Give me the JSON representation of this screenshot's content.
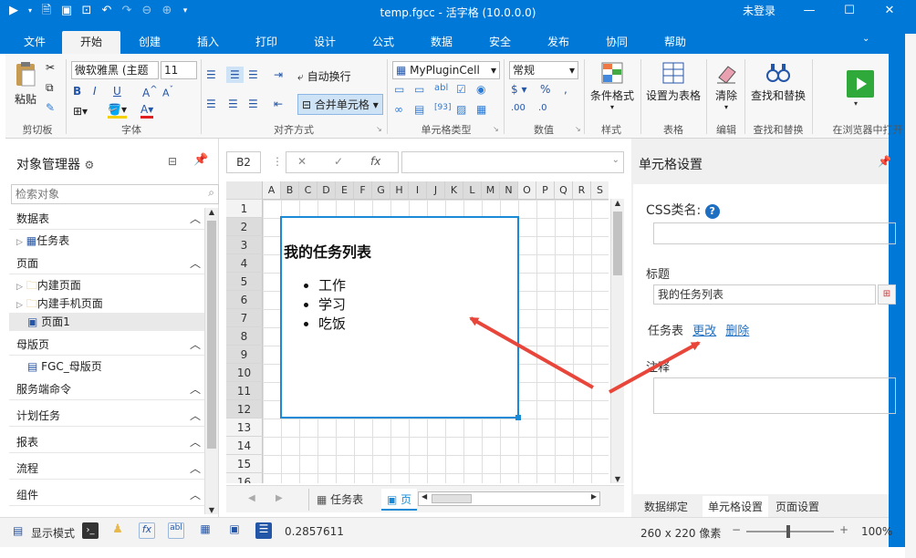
{
  "titlebar": {
    "title": "temp.fgcc - 活字格 (10.0.0.0)",
    "login_label": "未登录"
  },
  "ribbon_tabs": [
    "文件",
    "开始",
    "创建",
    "插入",
    "打印",
    "设计",
    "公式",
    "数据",
    "安全",
    "发布",
    "协同",
    "帮助"
  ],
  "ribbon": {
    "paste_label": "粘贴",
    "clipboard_group": "剪切板",
    "font_name": "微软雅黑 (主题",
    "font_size": "11",
    "font_group": "字体",
    "wrap_label": "自动换行",
    "merge_label": "合并单元格",
    "align_group": "对齐方式",
    "plugin_cell_value": "MyPluginCell",
    "celltype_group": "单元格类型",
    "number_format_value": "常规",
    "number_group": "数值",
    "cond_format_label": "条件格式",
    "style_group": "样式",
    "set_table_label": "设置为表格",
    "table_group": "表格",
    "clear_label": "清除",
    "edit_group": "编辑",
    "find_replace_label": "查找和替换",
    "find_group": "查找和替换",
    "open_browser_label": "在浏览器中打开"
  },
  "object_manager": {
    "title": "对象管理器",
    "search_placeholder": "检索对象",
    "sections": [
      {
        "label": "数据表",
        "items": [
          "任务表"
        ]
      },
      {
        "label": "页面",
        "items": [
          "内建页面",
          "内建手机页面",
          "页面1"
        ]
      },
      {
        "label": "母版页",
        "items": [
          "FGC_母版页"
        ]
      },
      {
        "label": "服务端命令"
      },
      {
        "label": "计划任务"
      },
      {
        "label": "报表"
      },
      {
        "label": "流程"
      },
      {
        "label": "组件"
      }
    ]
  },
  "formula_bar": {
    "cell_ref": "B2",
    "fx_label": "fx"
  },
  "sheet": {
    "columns": [
      "A",
      "B",
      "C",
      "D",
      "E",
      "F",
      "G",
      "H",
      "I",
      "J",
      "K",
      "L",
      "M",
      "N",
      "O",
      "P",
      "Q",
      "R",
      "S"
    ],
    "rows": [
      "1",
      "2",
      "3",
      "4",
      "5",
      "6",
      "7",
      "8",
      "9",
      "10",
      "11",
      "12",
      "13",
      "14",
      "15",
      "16"
    ],
    "cell_title": "我的任务列表",
    "cell_list": [
      "工作",
      "学习",
      "吃饭"
    ],
    "sheet_tabs": [
      "任务表",
      "页"
    ]
  },
  "cell_settings": {
    "title": "单元格设置",
    "css_label": "CSS类名:",
    "css_value": "",
    "title_label": "标题",
    "title_value": "我的任务列表",
    "table_label": "任务表",
    "change_link": "更改",
    "delete_link": "删除",
    "comment_label": "注释",
    "bottom_tabs": [
      "数据绑定",
      "单元格设置",
      "页面设置"
    ]
  },
  "statusbar": {
    "display_mode": "显示模式",
    "value": "0.2857611",
    "size": "260 x 220 像素",
    "zoom": "100%"
  },
  "colors": {
    "accent": "#0078d7",
    "selection": "#1b8ad6",
    "link": "#1e6fc2",
    "arrow": "#e8463a"
  }
}
